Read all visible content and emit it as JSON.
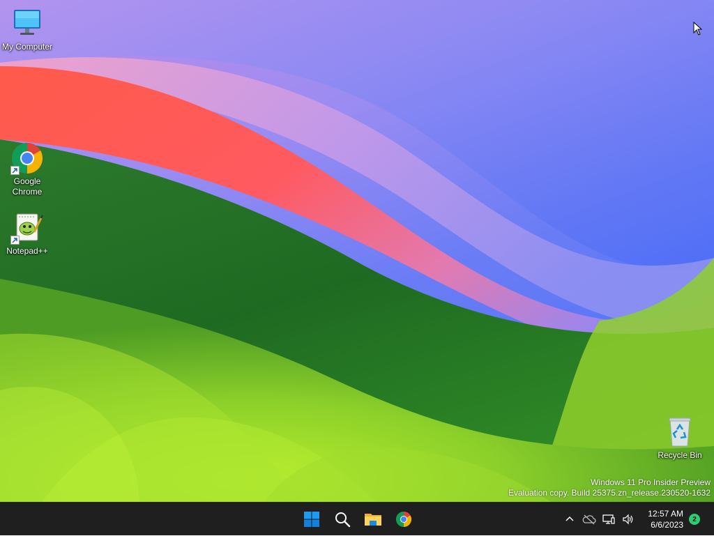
{
  "desktop": {
    "icons": [
      {
        "label": "My Computer",
        "icon": "monitor-icon"
      },
      {
        "label": "Google\nChrome",
        "label_line1": "Google",
        "label_line2": "Chrome",
        "icon": "chrome-icon"
      },
      {
        "label": "Notepad++",
        "icon": "notepadpp-icon"
      },
      {
        "label": "Recycle Bin",
        "icon": "recycle-bin-icon"
      }
    ],
    "watermark": {
      "line1": "Windows 11 Pro Insider Preview",
      "line2": "Evaluation copy. Build 25375.zn_release.230520-1632"
    }
  },
  "taskbar": {
    "pinned": [
      {
        "name": "start",
        "icon": "windows-logo-icon"
      },
      {
        "name": "search",
        "icon": "search-icon"
      },
      {
        "name": "file-explorer",
        "icon": "folder-icon"
      },
      {
        "name": "chrome",
        "icon": "chrome-icon"
      }
    ],
    "tray": {
      "icons": [
        "chevron-up-icon",
        "onedrive-offline-icon",
        "network-icon",
        "volume-icon"
      ],
      "time": "12:57 AM",
      "date": "6/6/2023",
      "notifications": "2"
    }
  },
  "colors": {
    "taskbar_bg": "#1f1f1f",
    "notification_badge": "#2ecc71",
    "win_blue": "#0078d4"
  }
}
